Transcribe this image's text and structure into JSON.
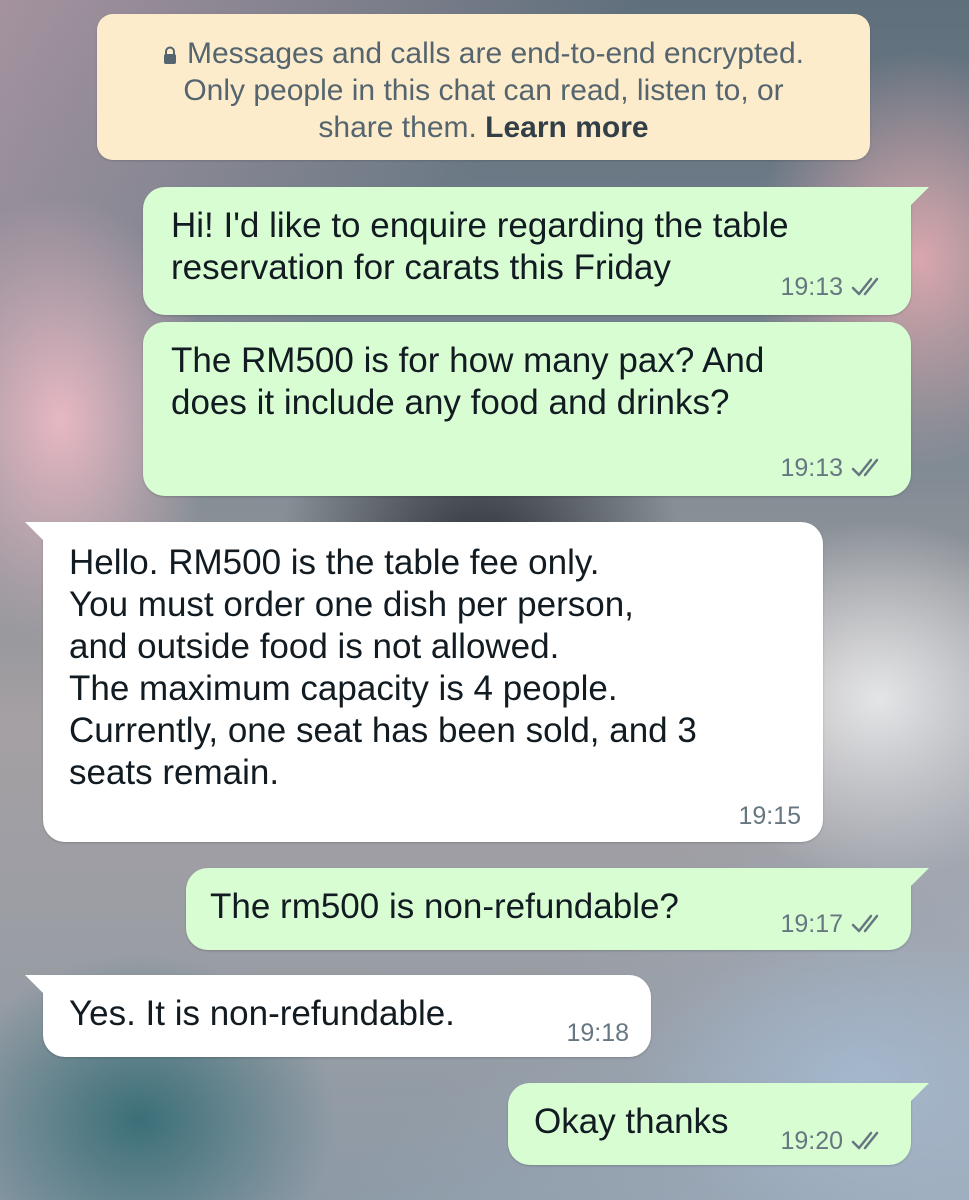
{
  "encryption_notice": {
    "line1": "Messages and calls are end-to-end encrypted.",
    "line2": "Only people in this chat can read, listen to, or",
    "line3_prefix": "share them. ",
    "learn_more": "Learn more",
    "icon": "lock-icon"
  },
  "messages": [
    {
      "direction": "outgoing",
      "text": "Hi! I'd like to enquire regarding the table\nreservation for carats this Friday",
      "time": "19:13",
      "status": "read",
      "status_icon": "double-check-icon"
    },
    {
      "direction": "outgoing",
      "text": "The RM500 is for how many pax? And\ndoes it include any food and drinks?",
      "time": "19:13",
      "status": "read",
      "status_icon": "double-check-icon"
    },
    {
      "direction": "incoming",
      "text": "Hello. RM500 is the table fee only.\nYou must order one dish per person,\nand outside food is not allowed.\nThe maximum capacity is 4 people.\nCurrently, one seat has been sold, and 3\nseats remain.",
      "time": "19:15"
    },
    {
      "direction": "outgoing",
      "text": "The rm500 is non-refundable?",
      "time": "19:17",
      "status": "read",
      "status_icon": "double-check-icon"
    },
    {
      "direction": "incoming",
      "text": "Yes. It is non-refundable.",
      "time": "19:18"
    },
    {
      "direction": "outgoing",
      "text": "Okay thanks",
      "time": "19:20",
      "status": "read",
      "status_icon": "double-check-icon"
    }
  ],
  "colors": {
    "outgoing_bubble": "#d9fdd3",
    "incoming_bubble": "#ffffff",
    "notice_background": "#fdeccb",
    "meta_text": "#667781"
  }
}
